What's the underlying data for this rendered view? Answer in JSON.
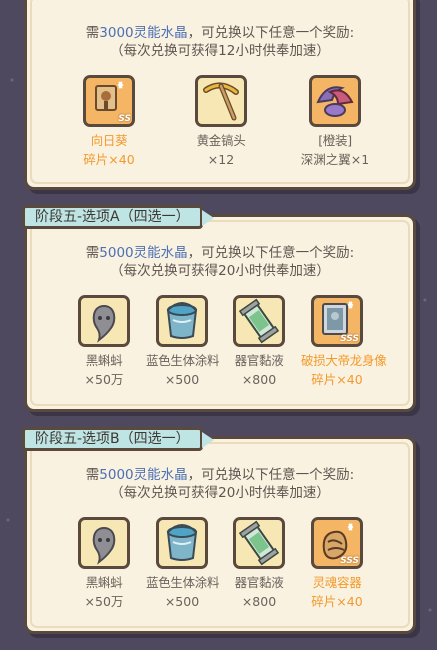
{
  "colors": {
    "background": "#4f4960",
    "card": "#faf2e0",
    "border": "#5a4a3e",
    "tab": "#bfe4e4",
    "highlight_number": "#4b6fb5",
    "fragment_orange": "#f29a2e"
  },
  "top_card": {
    "desc_prefix": "需",
    "desc_amount": "3000灵能水晶",
    "desc_suffix": "，可兑换以下任意一个奖励:",
    "desc_note": "（每次兑换可获得12小时供奉加速）",
    "items": [
      {
        "icon": "sunflower-fragment-icon",
        "name": "向日葵",
        "qty": "碎片×40",
        "badge": "SS"
      },
      {
        "icon": "gold-pickaxe-icon",
        "name": "黄金镐头",
        "qty": "×12"
      },
      {
        "icon": "abyss-wings-icon",
        "name": "[橙装]",
        "qty": "深渊之翼×1"
      }
    ]
  },
  "stage_a": {
    "tab_label": "阶段五-选项A（四选一）",
    "desc_prefix": "需",
    "desc_amount": "5000灵能水晶",
    "desc_suffix": "，可兑换以下任意一个奖励:",
    "desc_note": "（每次兑换可获得20小时供奉加速）",
    "items": [
      {
        "icon": "tadpole-icon",
        "name": "黑蝌蚪",
        "qty": "×50万"
      },
      {
        "icon": "blue-paint-bucket-icon",
        "name": "蓝色生体涂料",
        "qty": "×500"
      },
      {
        "icon": "organ-mucus-icon",
        "name": "器官黏液",
        "qty": "×800"
      },
      {
        "icon": "emperor-statue-fragment-icon",
        "name": "破损大帝龙身像",
        "qty": "碎片×40",
        "badge": "SSS"
      }
    ]
  },
  "stage_b": {
    "tab_label": "阶段五-选项B（四选一）",
    "desc_prefix": "需",
    "desc_amount": "5000灵能水晶",
    "desc_suffix": "，可兑换以下任意一个奖励:",
    "desc_note": "（每次兑换可获得20小时供奉加速）",
    "items": [
      {
        "icon": "tadpole-icon",
        "name": "黑蝌蚪",
        "qty": "×50万"
      },
      {
        "icon": "blue-paint-bucket-icon",
        "name": "蓝色生体涂料",
        "qty": "×500"
      },
      {
        "icon": "organ-mucus-icon",
        "name": "器官黏液",
        "qty": "×800"
      },
      {
        "icon": "soul-container-fragment-icon",
        "name": "灵魂容器",
        "qty": "碎片×40",
        "badge": "SSS"
      }
    ]
  }
}
